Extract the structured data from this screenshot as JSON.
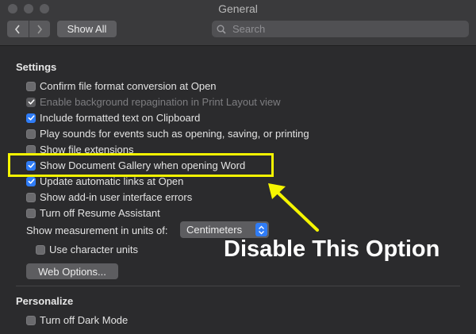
{
  "window": {
    "title": "General"
  },
  "toolbar": {
    "show_all_label": "Show All",
    "search_placeholder": "Search"
  },
  "settings": {
    "title": "Settings",
    "options": [
      {
        "label": "Confirm file format conversion at Open",
        "checked": false,
        "enabled": true
      },
      {
        "label": "Enable background repagination in Print Layout view",
        "checked": true,
        "enabled": false
      },
      {
        "label": "Include formatted text on Clipboard",
        "checked": true,
        "enabled": true
      },
      {
        "label": "Play sounds for events such as opening, saving, or printing",
        "checked": false,
        "enabled": true
      },
      {
        "label": "Show file extensions",
        "checked": false,
        "enabled": true
      },
      {
        "label": "Show Document Gallery when opening Word",
        "checked": true,
        "enabled": true
      },
      {
        "label": "Update automatic links at Open",
        "checked": true,
        "enabled": true
      },
      {
        "label": "Show add-in user interface errors",
        "checked": false,
        "enabled": true
      },
      {
        "label": "Turn off Resume Assistant",
        "checked": false,
        "enabled": true
      }
    ],
    "units_label": "Show measurement in units of:",
    "units_value": "Centimeters",
    "character_units_label": "Use character units",
    "web_options_label": "Web Options..."
  },
  "personalize": {
    "title": "Personalize",
    "dark_mode_label": "Turn off Dark Mode"
  },
  "annotation": {
    "text": "Disable This Option",
    "highlight_color": "#f5f500"
  },
  "colors": {
    "accent": "#2f7cf6",
    "background": "#2b2b2d"
  },
  "icons": {
    "back": "chevron-left-icon",
    "forward": "chevron-right-icon",
    "search": "search-icon",
    "checkbox_check": "checkmark-icon",
    "stepper": "up-down-chevron-icon"
  }
}
